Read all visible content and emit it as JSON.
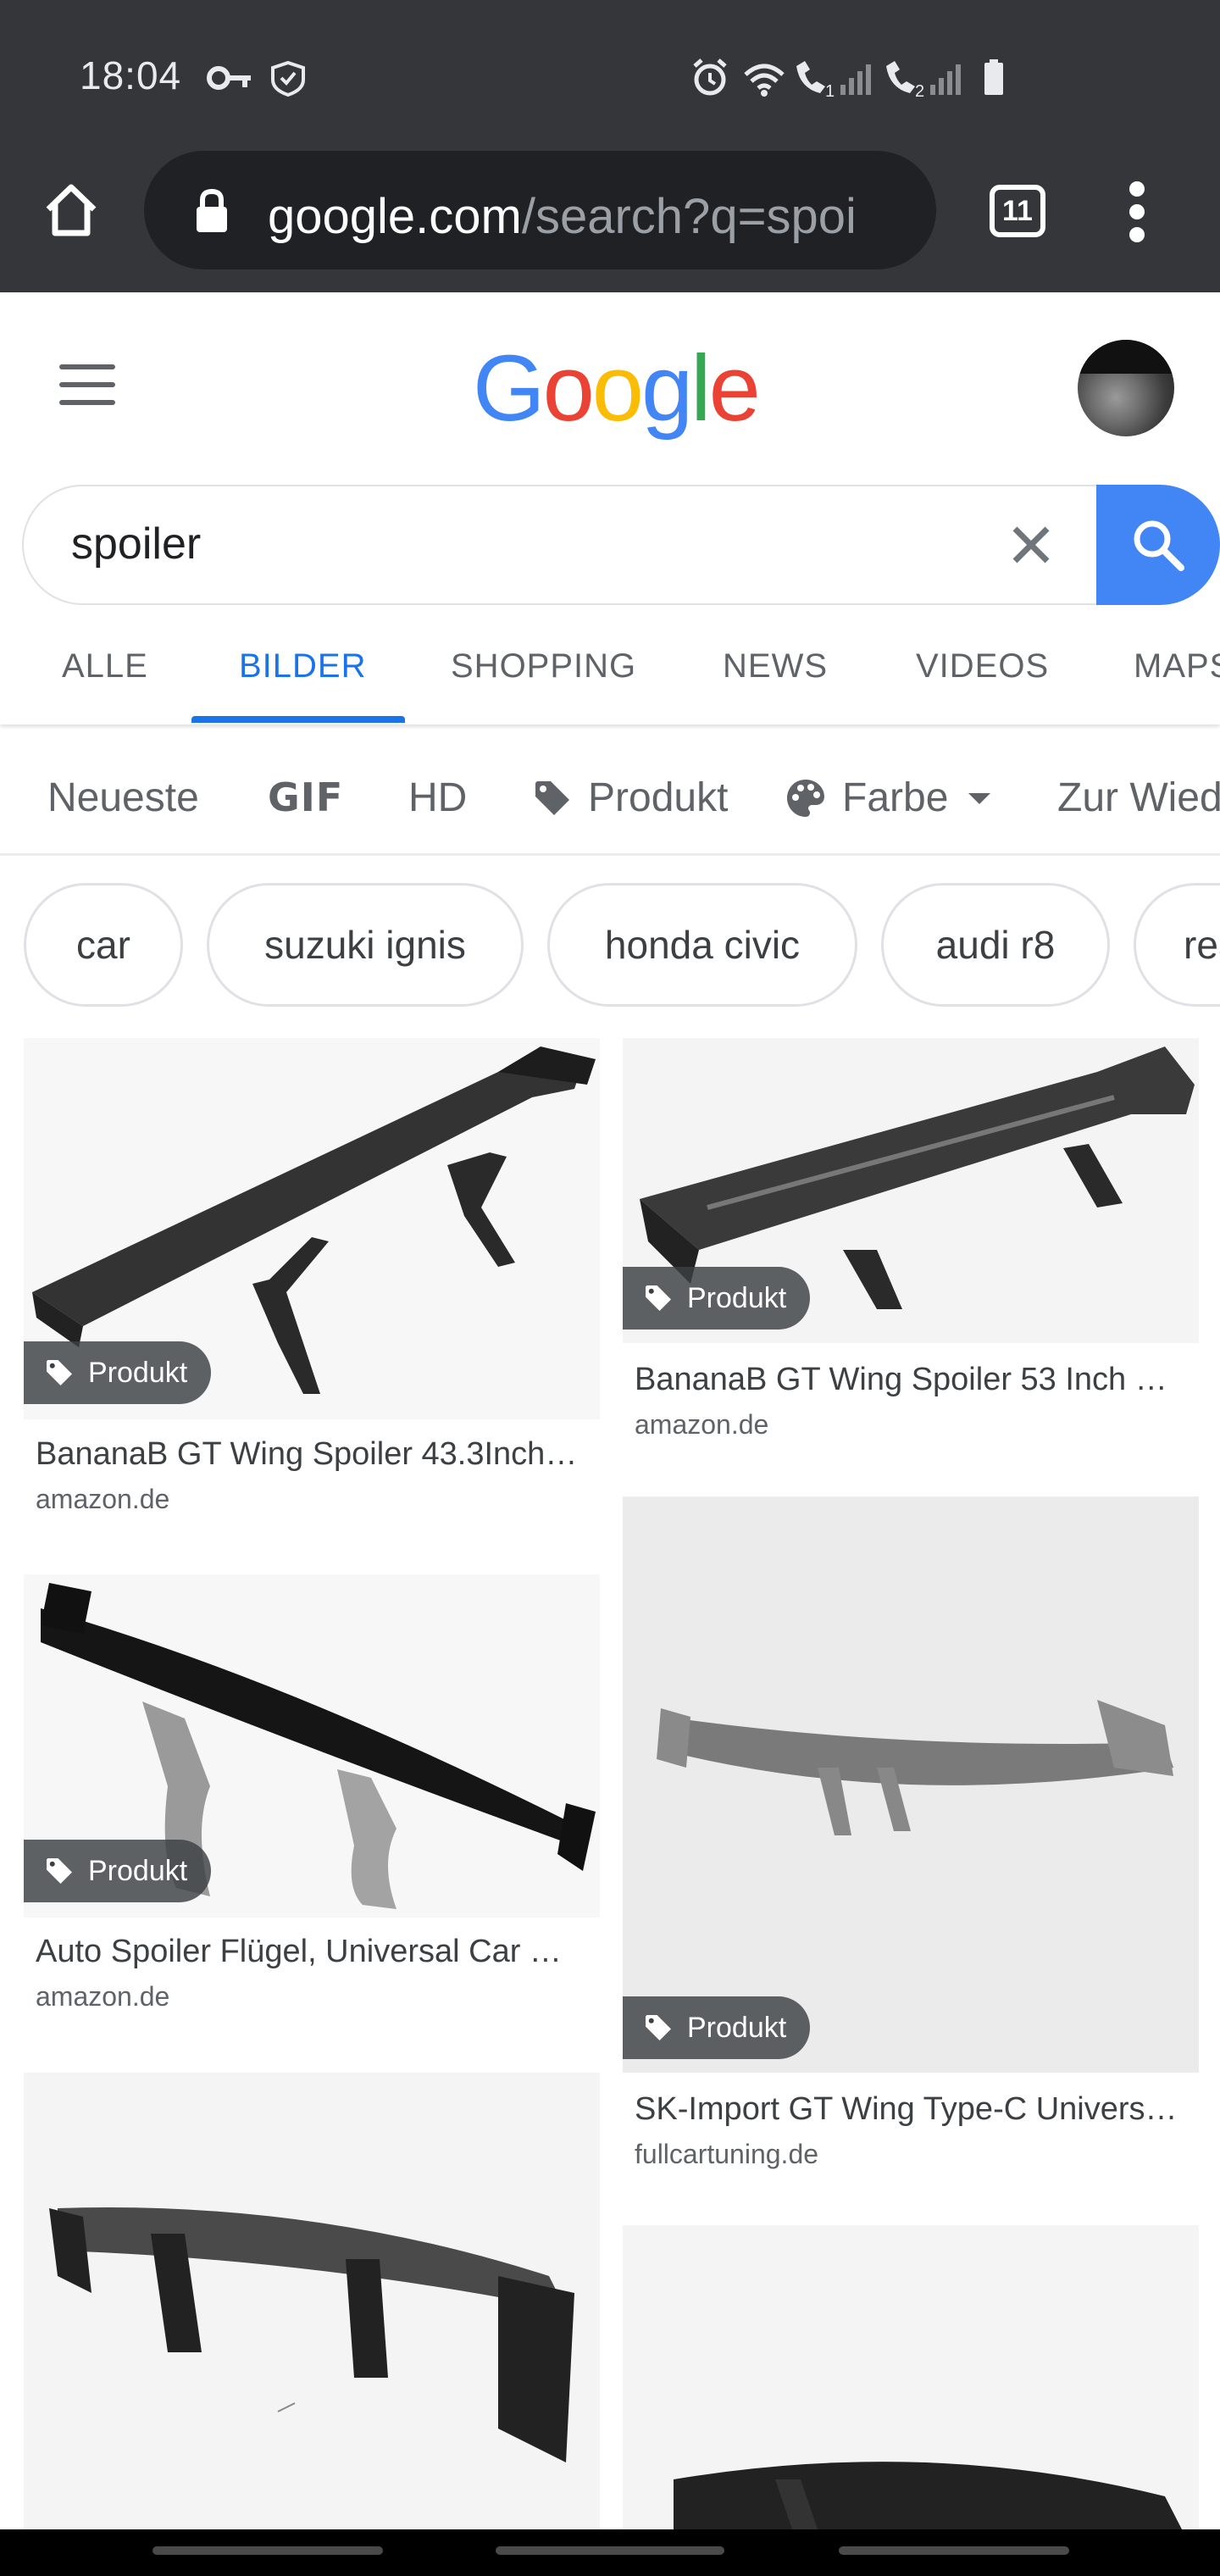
{
  "status_bar": {
    "time": "18:04",
    "sim1": "1",
    "sim2": "2"
  },
  "browser": {
    "url_host": "google.com",
    "url_path": "/search?q=spoi",
    "tab_count": "11"
  },
  "google": {
    "logo": {
      "text": [
        "G",
        "o",
        "o",
        "g",
        "l",
        "e"
      ],
      "colors": [
        "#4285F4",
        "#EA4335",
        "#FBBC05",
        "#4285F4",
        "#34A853",
        "#EA4335"
      ]
    },
    "search_query": "spoiler"
  },
  "tabs": [
    "ALLE",
    "BILDER",
    "SHOPPING",
    "NEWS",
    "VIDEOS",
    "MAPS"
  ],
  "active_tab": "BILDER",
  "filters": {
    "newest": "Neueste",
    "gif": "GIF",
    "hd": "HD",
    "product": "Produkt",
    "color": "Farbe",
    "reuse": "Zur Wiederverwendung"
  },
  "chips": [
    "car",
    "suzuki ignis",
    "honda civic",
    "audi r8",
    "rear"
  ],
  "results": [
    {
      "title": "BananaB GT Wing Spoiler 43.3Inch…",
      "source": "amazon.de",
      "badge": "Produkt"
    },
    {
      "title": "BananaB GT Wing Spoiler 53 Inch …",
      "source": "amazon.de",
      "badge": "Produkt"
    },
    {
      "title": "Auto Spoiler Flügel, Universal Car …",
      "source": "amazon.de",
      "badge": "Produkt"
    },
    {
      "title": "SK-Import GT Wing Type-C Univers…",
      "source": "fullcartuning.de",
      "badge": "Produkt"
    }
  ],
  "colors": {
    "accent": "#1a73e8",
    "search_button": "#4285f4",
    "chrome": "#35363a"
  }
}
